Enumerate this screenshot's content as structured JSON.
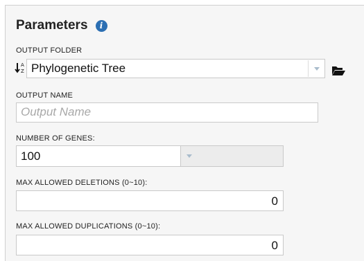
{
  "header": {
    "title": "Parameters",
    "info_icon": "info-icon"
  },
  "output_folder": {
    "label": "OUTPUT FOLDER",
    "sort_icon": "sort-alpha-icon",
    "value": "Phylogenetic Tree",
    "browse_icon": "folder-open-icon"
  },
  "output_name": {
    "label": "OUTPUT NAME",
    "placeholder": "Output Name",
    "value": ""
  },
  "number_of_genes": {
    "label": "NUMBER OF GENES:",
    "value": "100"
  },
  "max_deletions": {
    "label": "MAX ALLOWED DELETIONS (0~10):",
    "value": "0"
  },
  "max_duplications": {
    "label": "MAX ALLOWED DUPLICATIONS (0~10):",
    "value": "0"
  },
  "colors": {
    "accent": "#2c6fb3",
    "caret": "#a9bccc"
  }
}
